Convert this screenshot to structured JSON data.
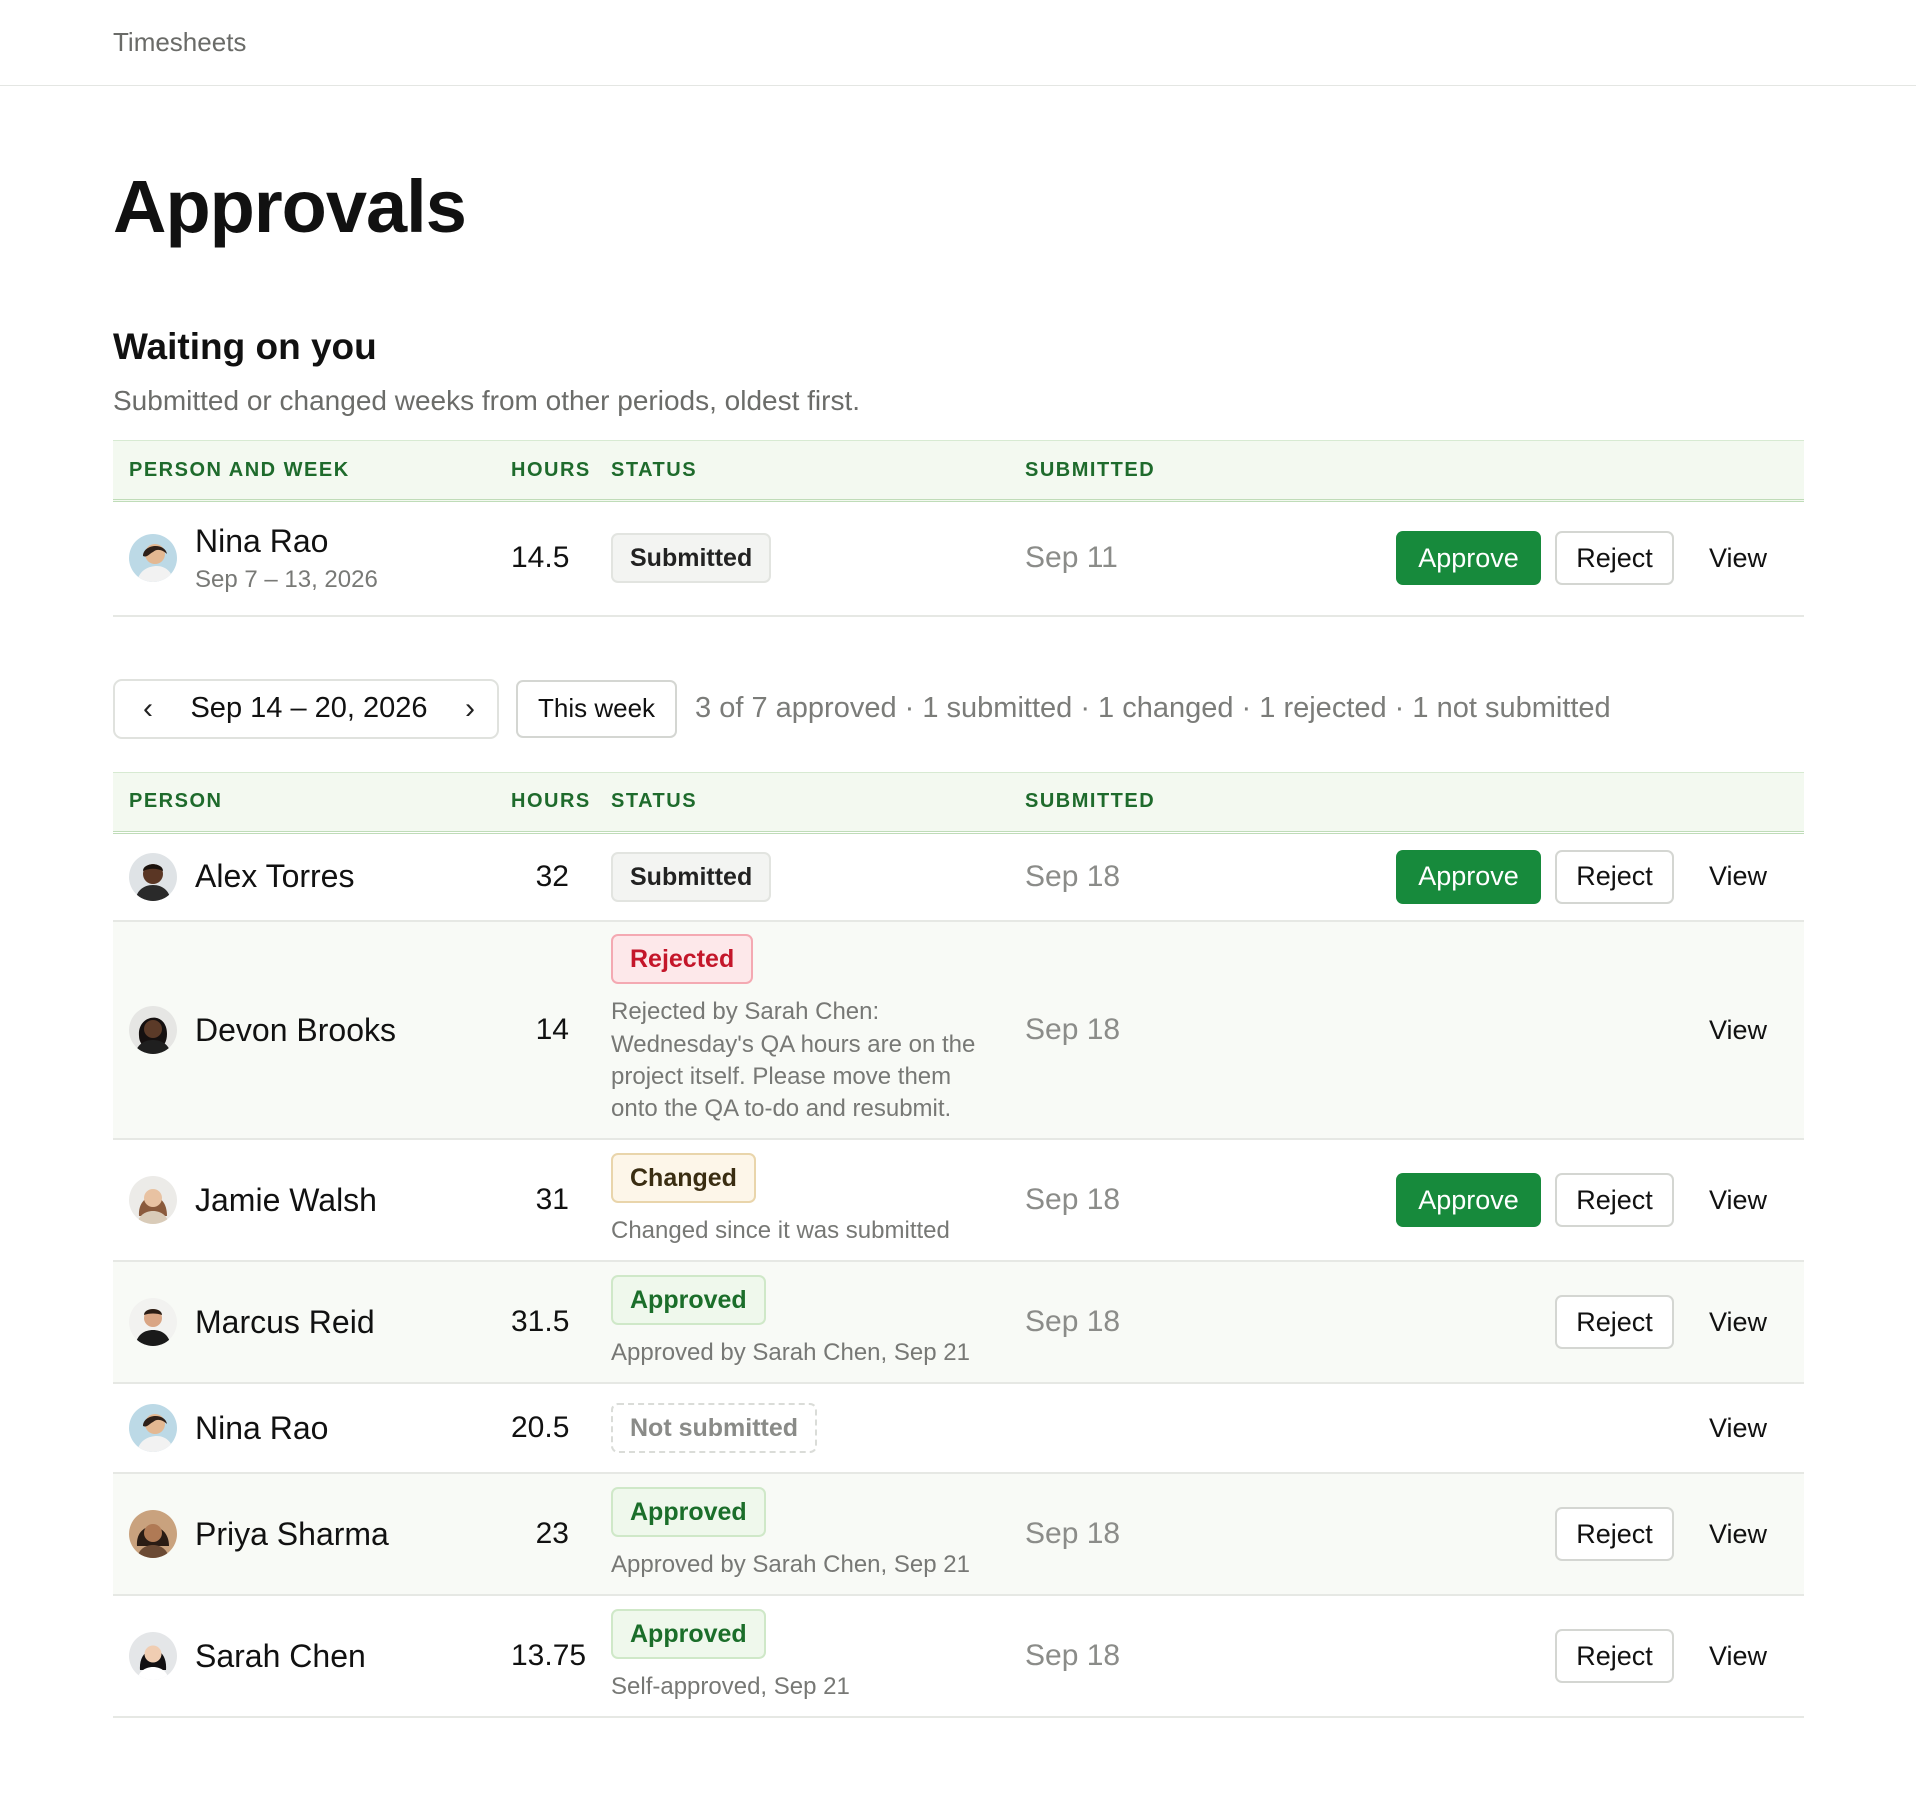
{
  "app": {
    "breadcrumb": "Timesheets"
  },
  "page": {
    "title": "Approvals"
  },
  "waiting": {
    "title": "Waiting on you",
    "subtitle": "Submitted or changed weeks from other periods, oldest first.",
    "columns": {
      "person": "PERSON AND WEEK",
      "hours": "HOURS",
      "status": "STATUS",
      "submitted": "SUBMITTED"
    },
    "rows": [
      {
        "name": "Nina Rao",
        "week": "Sep 7 – 13, 2026",
        "hours": "14.5",
        "status": "Submitted",
        "submitted": "Sep 11",
        "approve": "Approve",
        "reject": "Reject",
        "view": "View"
      }
    ]
  },
  "week": {
    "prev_icon": "chevron-left-icon",
    "next_icon": "chevron-right-icon",
    "range": "Sep 14 – 20, 2026",
    "this_week": "This week",
    "summary": "3 of 7 approved · 1 submitted · 1 changed · 1 rejected · 1 not submitted",
    "columns": {
      "person": "PERSON",
      "hours": "HOURS",
      "status": "STATUS",
      "submitted": "SUBMITTED"
    },
    "rows": [
      {
        "name": "Alex Torres",
        "hours": "32",
        "status": "Submitted",
        "note": "",
        "submitted": "Sep 18",
        "approve": "Approve",
        "reject": "Reject",
        "view": "View"
      },
      {
        "name": "Devon Brooks",
        "hours": "14",
        "status": "Rejected",
        "note": "Rejected by Sarah Chen: Wednesday's QA hours are on the project itself. Please move them onto the QA to-do and resubmit.",
        "submitted": "Sep 18",
        "view": "View"
      },
      {
        "name": "Jamie Walsh",
        "hours": "31",
        "status": "Changed",
        "note": "Changed since it was submitted",
        "submitted": "Sep 18",
        "approve": "Approve",
        "reject": "Reject",
        "view": "View"
      },
      {
        "name": "Marcus Reid",
        "hours": "31.5",
        "status": "Approved",
        "note": "Approved by Sarah Chen, Sep 21",
        "submitted": "Sep 18",
        "reject": "Reject",
        "view": "View"
      },
      {
        "name": "Nina Rao",
        "hours": "20.5",
        "status": "Not submitted",
        "view": "View"
      },
      {
        "name": "Priya Sharma",
        "hours": "23",
        "status": "Approved",
        "note": "Approved by Sarah Chen, Sep 21",
        "submitted": "Sep 18",
        "reject": "Reject",
        "view": "View"
      },
      {
        "name": "Sarah Chen",
        "hours": "13.75",
        "status": "Approved",
        "note": "Self-approved, Sep 21",
        "submitted": "Sep 18",
        "reject": "Reject",
        "view": "View"
      }
    ]
  },
  "colors": {
    "accent": "#178a3c",
    "header_text": "#1e6b2c",
    "header_bg": "#f3f9f0",
    "rejected": "#c4162a"
  }
}
